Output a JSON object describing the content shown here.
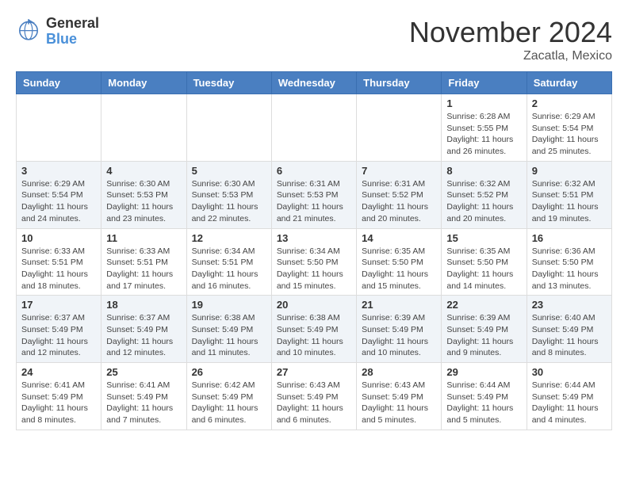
{
  "logo": {
    "general": "General",
    "blue": "Blue"
  },
  "header": {
    "month": "November 2024",
    "location": "Zacatla, Mexico"
  },
  "days_of_week": [
    "Sunday",
    "Monday",
    "Tuesday",
    "Wednesday",
    "Thursday",
    "Friday",
    "Saturday"
  ],
  "weeks": [
    [
      {
        "day": "",
        "info": ""
      },
      {
        "day": "",
        "info": ""
      },
      {
        "day": "",
        "info": ""
      },
      {
        "day": "",
        "info": ""
      },
      {
        "day": "",
        "info": ""
      },
      {
        "day": "1",
        "info": "Sunrise: 6:28 AM\nSunset: 5:55 PM\nDaylight: 11 hours and 26 minutes."
      },
      {
        "day": "2",
        "info": "Sunrise: 6:29 AM\nSunset: 5:54 PM\nDaylight: 11 hours and 25 minutes."
      }
    ],
    [
      {
        "day": "3",
        "info": "Sunrise: 6:29 AM\nSunset: 5:54 PM\nDaylight: 11 hours and 24 minutes."
      },
      {
        "day": "4",
        "info": "Sunrise: 6:30 AM\nSunset: 5:53 PM\nDaylight: 11 hours and 23 minutes."
      },
      {
        "day": "5",
        "info": "Sunrise: 6:30 AM\nSunset: 5:53 PM\nDaylight: 11 hours and 22 minutes."
      },
      {
        "day": "6",
        "info": "Sunrise: 6:31 AM\nSunset: 5:53 PM\nDaylight: 11 hours and 21 minutes."
      },
      {
        "day": "7",
        "info": "Sunrise: 6:31 AM\nSunset: 5:52 PM\nDaylight: 11 hours and 20 minutes."
      },
      {
        "day": "8",
        "info": "Sunrise: 6:32 AM\nSunset: 5:52 PM\nDaylight: 11 hours and 20 minutes."
      },
      {
        "day": "9",
        "info": "Sunrise: 6:32 AM\nSunset: 5:51 PM\nDaylight: 11 hours and 19 minutes."
      }
    ],
    [
      {
        "day": "10",
        "info": "Sunrise: 6:33 AM\nSunset: 5:51 PM\nDaylight: 11 hours and 18 minutes."
      },
      {
        "day": "11",
        "info": "Sunrise: 6:33 AM\nSunset: 5:51 PM\nDaylight: 11 hours and 17 minutes."
      },
      {
        "day": "12",
        "info": "Sunrise: 6:34 AM\nSunset: 5:51 PM\nDaylight: 11 hours and 16 minutes."
      },
      {
        "day": "13",
        "info": "Sunrise: 6:34 AM\nSunset: 5:50 PM\nDaylight: 11 hours and 15 minutes."
      },
      {
        "day": "14",
        "info": "Sunrise: 6:35 AM\nSunset: 5:50 PM\nDaylight: 11 hours and 15 minutes."
      },
      {
        "day": "15",
        "info": "Sunrise: 6:35 AM\nSunset: 5:50 PM\nDaylight: 11 hours and 14 minutes."
      },
      {
        "day": "16",
        "info": "Sunrise: 6:36 AM\nSunset: 5:50 PM\nDaylight: 11 hours and 13 minutes."
      }
    ],
    [
      {
        "day": "17",
        "info": "Sunrise: 6:37 AM\nSunset: 5:49 PM\nDaylight: 11 hours and 12 minutes."
      },
      {
        "day": "18",
        "info": "Sunrise: 6:37 AM\nSunset: 5:49 PM\nDaylight: 11 hours and 12 minutes."
      },
      {
        "day": "19",
        "info": "Sunrise: 6:38 AM\nSunset: 5:49 PM\nDaylight: 11 hours and 11 minutes."
      },
      {
        "day": "20",
        "info": "Sunrise: 6:38 AM\nSunset: 5:49 PM\nDaylight: 11 hours and 10 minutes."
      },
      {
        "day": "21",
        "info": "Sunrise: 6:39 AM\nSunset: 5:49 PM\nDaylight: 11 hours and 10 minutes."
      },
      {
        "day": "22",
        "info": "Sunrise: 6:39 AM\nSunset: 5:49 PM\nDaylight: 11 hours and 9 minutes."
      },
      {
        "day": "23",
        "info": "Sunrise: 6:40 AM\nSunset: 5:49 PM\nDaylight: 11 hours and 8 minutes."
      }
    ],
    [
      {
        "day": "24",
        "info": "Sunrise: 6:41 AM\nSunset: 5:49 PM\nDaylight: 11 hours and 8 minutes."
      },
      {
        "day": "25",
        "info": "Sunrise: 6:41 AM\nSunset: 5:49 PM\nDaylight: 11 hours and 7 minutes."
      },
      {
        "day": "26",
        "info": "Sunrise: 6:42 AM\nSunset: 5:49 PM\nDaylight: 11 hours and 6 minutes."
      },
      {
        "day": "27",
        "info": "Sunrise: 6:43 AM\nSunset: 5:49 PM\nDaylight: 11 hours and 6 minutes."
      },
      {
        "day": "28",
        "info": "Sunrise: 6:43 AM\nSunset: 5:49 PM\nDaylight: 11 hours and 5 minutes."
      },
      {
        "day": "29",
        "info": "Sunrise: 6:44 AM\nSunset: 5:49 PM\nDaylight: 11 hours and 5 minutes."
      },
      {
        "day": "30",
        "info": "Sunrise: 6:44 AM\nSunset: 5:49 PM\nDaylight: 11 hours and 4 minutes."
      }
    ]
  ]
}
